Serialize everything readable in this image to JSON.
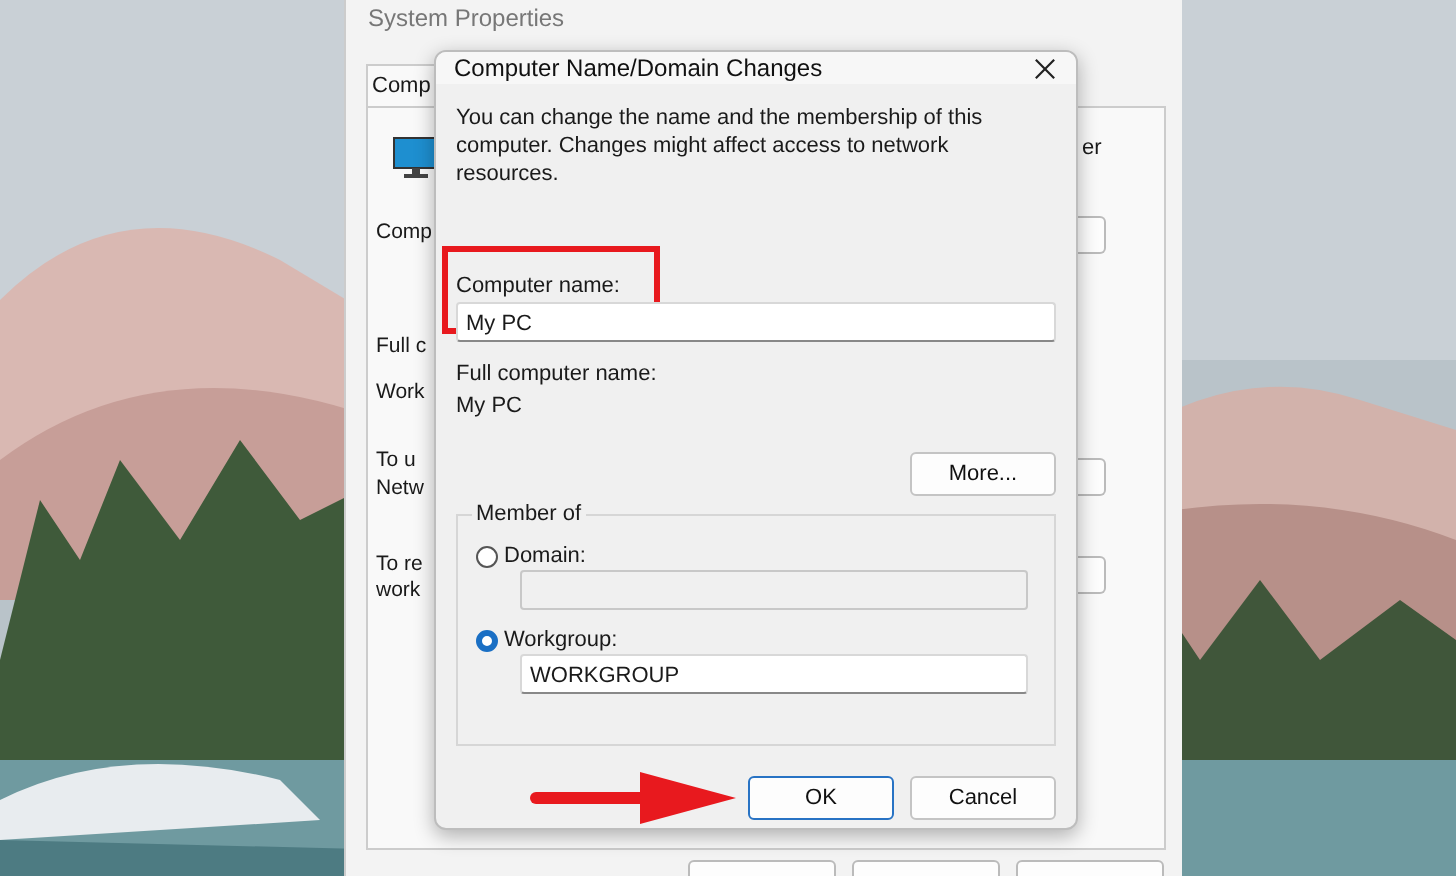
{
  "back_window": {
    "title": "System Properties",
    "tab": "Comp",
    "side_text": "er",
    "lines": [
      {
        "text": "Comp"
      },
      {
        "text": "Full c"
      },
      {
        "text": "Work"
      },
      {
        "text": "To u"
      },
      {
        "text": "Netw"
      },
      {
        "text": "To re"
      },
      {
        "text": "work"
      }
    ]
  },
  "dialog": {
    "title": "Computer Name/Domain Changes",
    "description": "You can change the name and the membership of this computer. Changes might affect access to network resources.",
    "computer_name": {
      "label": "Computer name:",
      "value": "My PC",
      "highlighted": true
    },
    "full_name_label": "Full computer name:",
    "full_name": "My PC",
    "more_button": "More...",
    "member_of": {
      "title": "Member of",
      "options": [
        {
          "label": "Domain:",
          "selected": false,
          "disabled": true
        },
        {
          "label": "Workgroup:",
          "selected": true,
          "disabled": false,
          "value": "WORKGROUP"
        }
      ]
    },
    "buttons": [
      {
        "label": "OK",
        "default": true,
        "pointed": true
      },
      {
        "label": "Cancel",
        "default": false,
        "pointed": false
      }
    ]
  }
}
